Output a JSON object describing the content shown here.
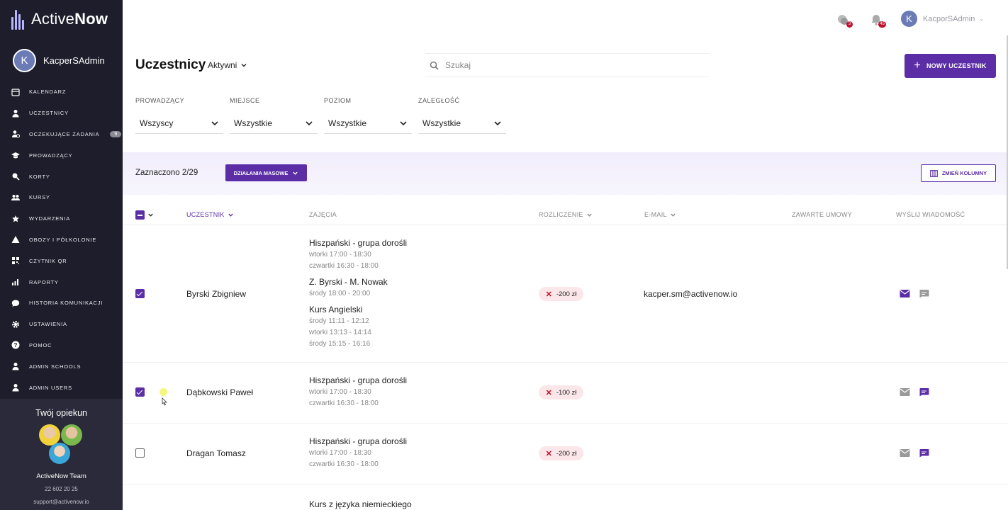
{
  "app": {
    "brand_light": "Active",
    "brand_bold": "Now"
  },
  "sidebar": {
    "user_initial": "K",
    "user_name": "KacperSAdmin",
    "items": [
      {
        "label": "Kalendarz",
        "icon": "calendar-icon"
      },
      {
        "label": "Uczestnicy",
        "icon": "user-icon"
      },
      {
        "label": "Oczekujące zadania",
        "icon": "user-clock-icon",
        "badge": "9"
      },
      {
        "label": "Prowadzący",
        "icon": "graduation-cap-icon"
      },
      {
        "label": "Korty",
        "icon": "racket-icon"
      },
      {
        "label": "Kursy",
        "icon": "users-icon"
      },
      {
        "label": "Wydarzenia",
        "icon": "events-icon"
      },
      {
        "label": "Obozy i półkolonie",
        "icon": "tent-icon"
      },
      {
        "label": "Czytnik QR",
        "icon": "qr-icon"
      },
      {
        "label": "Raporty",
        "icon": "chart-icon"
      },
      {
        "label": "Historia komunikacji",
        "icon": "chat-icon"
      },
      {
        "label": "Ustawienia",
        "icon": "gear-icon"
      },
      {
        "label": "Pomoc",
        "icon": "help-icon"
      },
      {
        "label": "Admin schools",
        "icon": "user-icon"
      },
      {
        "label": "Admin users",
        "icon": "user-icon"
      }
    ],
    "guardian": {
      "title": "Twój opiekun",
      "team": "ActiveNow Team",
      "phone": "22 602 20 25",
      "email": "support@activenow.io"
    }
  },
  "topbar": {
    "chat_badge": "3",
    "notif_badge": "45",
    "user_initial": "K",
    "user_name": "KacporSAdmin"
  },
  "header": {
    "title": "Uczestnicy",
    "status": "Aktywni",
    "search_placeholder": "Szukaj",
    "new_button": "NOWY UCZESTNIK"
  },
  "filters": [
    {
      "label": "Prowadzący",
      "value": "Wszyscy"
    },
    {
      "label": "Miejsce",
      "value": "Wszystkie"
    },
    {
      "label": "Poziom",
      "value": "Wszystkie"
    },
    {
      "label": "Zaległość",
      "value": "Wszystkie"
    }
  ],
  "mass": {
    "selected": "Zaznaczono 2/29",
    "mass_button": "DZIAŁANIA MASOWE",
    "columns_button": "ZMIEŃ KOLUMNY"
  },
  "table": {
    "columns": {
      "participant": "Uczestnik",
      "classes": "Zajęcia",
      "billing": "Rozliczenie",
      "email": "E-mail",
      "contracts": "Zawarte umowy",
      "send_message": "Wyślij wiadomość"
    },
    "rows": [
      {
        "name": "Byrski Zbigniew",
        "checked": true,
        "balance": "-200 zł",
        "email": "kacper.sm@activenow.io",
        "courses": [
          {
            "title": "Hiszpański - grupa dorośli",
            "times": [
              "wtorki 17:00 - 18:30",
              "czwartki 16:30 - 18:00"
            ]
          },
          {
            "title": "Z. Byrski - M. Nowak",
            "times": [
              "środy 18:00 - 20:00"
            ]
          },
          {
            "title": "Kurs Angielski",
            "times": [
              "środy 11:11 - 12:12",
              "wtorki 13:13 - 14:14",
              "środy 15:15 - 16:16"
            ]
          }
        ]
      },
      {
        "name": "Dąbkowski Paweł",
        "checked": true,
        "balance": "-100 zł",
        "email": "",
        "courses": [
          {
            "title": "Hiszpański - grupa dorośli",
            "times": [
              "wtorki 17:00 - 18:30",
              "czwartki 16:30 - 18:00"
            ]
          }
        ]
      },
      {
        "name": "Dragan Tomasz",
        "checked": false,
        "balance": "-200 zł",
        "email": "",
        "courses": [
          {
            "title": "Hiszpański - grupa dorośli",
            "times": [
              "wtorki 17:00 - 18:30",
              "czwartki 16:30 - 18:00"
            ]
          }
        ]
      },
      {
        "name": "",
        "checked": false,
        "balance": "",
        "email": "",
        "courses": [
          {
            "title": "Kurs z języka niemieckiego",
            "times": []
          }
        ]
      }
    ]
  },
  "colors": {
    "accent": "#5b2ea6",
    "sidebar": "#1d1d2b",
    "debt_bg": "#fbe7ea",
    "debt_x": "#c0102c"
  }
}
